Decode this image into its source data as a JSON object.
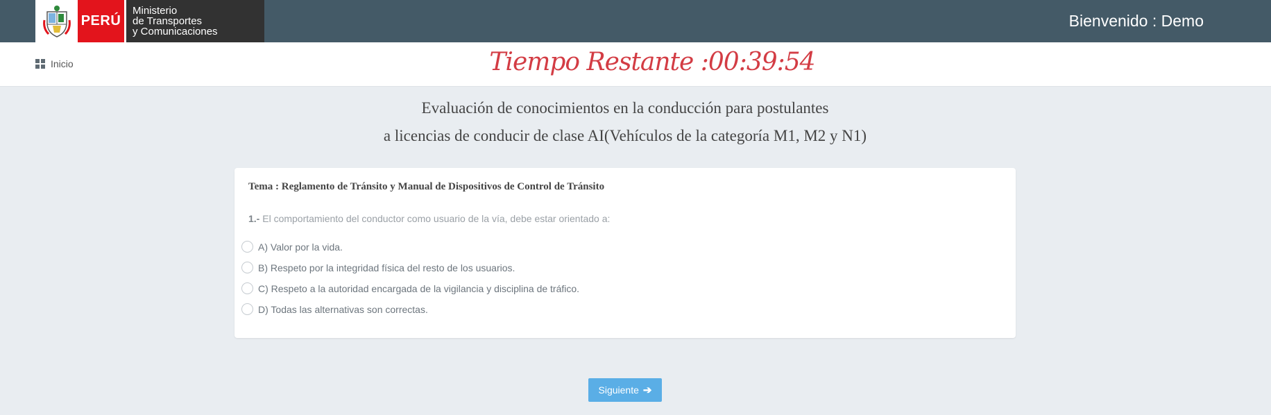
{
  "header": {
    "logo_country": "PERÚ",
    "logo_ministry_lines": [
      "Ministerio",
      "de Transportes",
      "y Comunicaciones"
    ],
    "welcome": "Bienvenido : Demo",
    "background_color": "#445a67"
  },
  "subbar": {
    "home_label": "Inicio",
    "timer": "Tiempo Restante :00:39:54",
    "timer_color": "#d33c44"
  },
  "exam": {
    "title_line1": "Evaluación de conocimientos en la conducción para postulantes",
    "title_line2": "a licencias de conducir de clase AI(Vehículos de la categoría M1, M2 y N1)",
    "topic": "Tema : Reglamento de Tránsito y Manual de Dispositivos de Control de Tránsito",
    "question_number": "1.-",
    "question_text": " El comportamiento del conductor como usuario de la vía, debe estar orientado a:",
    "options": [
      "A) Valor por la vida.",
      "B) Respeto por la integridad física del resto de los usuarios.",
      "C) Respeto a la autoridad encargada de la vigilancia y disciplina de tráfico.",
      "D) Todas las alternativas son correctas."
    ]
  },
  "actions": {
    "next_label": "Siguiente",
    "next_icon": "arrow-right-icon",
    "accent": "#5aaee6"
  }
}
